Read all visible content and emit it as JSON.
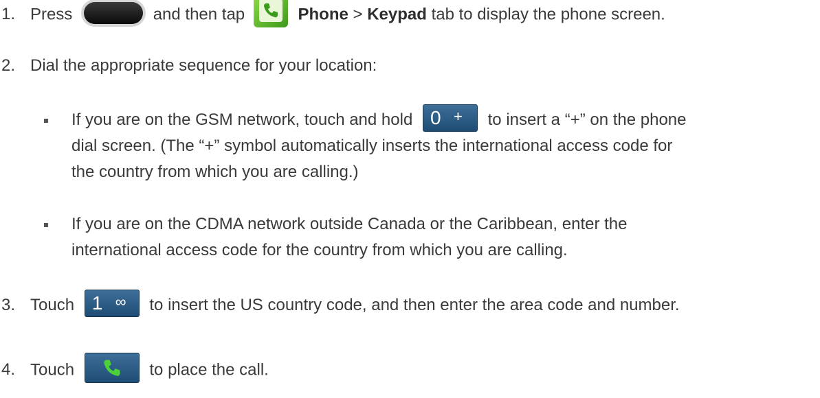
{
  "steps": [
    {
      "num": "1.",
      "pre": "Press",
      "mid": "and then tap",
      "bold1": "Phone",
      "sep": ">",
      "bold2": "Keypad",
      "post": "tab to display the phone screen."
    },
    {
      "num": "2.",
      "text": "Dial the appropriate sequence for your location:"
    },
    {
      "num": "3.",
      "pre": "Touch",
      "post": "to insert the US country code, and then enter the area code and number."
    },
    {
      "num": "4.",
      "pre": "Touch",
      "post": "to place the call."
    }
  ],
  "bullets": [
    {
      "pre": "If you are on the GSM network, touch and hold",
      "post": "to insert a “+” on the phone",
      "line2": "dial screen. (The “+” symbol automatically inserts the international access code for",
      "line3": "the country from which you are calling.)"
    },
    {
      "line1": "If you are on the CDMA network outside Canada or the Caribbean, enter the",
      "line2": "international access code for the country from which you are calling."
    }
  ],
  "keys": {
    "zero": {
      "digit": "0",
      "symbol": "+"
    },
    "one": {
      "digit": "1",
      "symbol": "∞"
    }
  },
  "icons": {
    "home": "home-button-icon",
    "phone_app": "phone-app-icon",
    "call": "call-button-icon"
  },
  "colors": {
    "key_blue": "#2b5d88",
    "phone_green": "#4caf25",
    "text": "#3a3a3a"
  }
}
